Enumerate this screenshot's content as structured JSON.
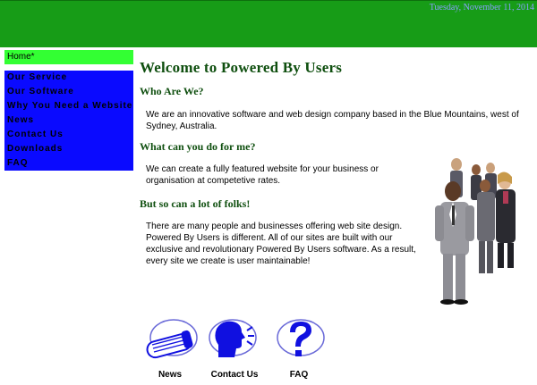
{
  "header": {
    "date": "Tuesday, November 11, 2014"
  },
  "nav": {
    "items": [
      {
        "label": "Home*",
        "active": true
      },
      {
        "label": "Our Service",
        "active": false
      },
      {
        "label": "Our Software",
        "active": false
      },
      {
        "label": "Why You Need a Website",
        "active": false
      },
      {
        "label": "News",
        "active": false
      },
      {
        "label": "Contact Us",
        "active": false
      },
      {
        "label": "Downloads",
        "active": false
      },
      {
        "label": "FAQ",
        "active": false
      }
    ]
  },
  "main": {
    "title": "Welcome to Powered By Users",
    "sections": [
      {
        "heading": "Who Are We?",
        "text": "We are an innovative software and web design company based in the Blue Mountains, west of Sydney, Australia."
      },
      {
        "heading": "What can you do for me?",
        "text": "We can create a fully featured website for your business or organisation at competetive rates."
      },
      {
        "heading": "But so can a lot of folks!",
        "text": "There are many people and businesses offering web site design. Powered By Users is different. All of our sites are built with our exclusive and revolutionary Powered By Users software. As a result, every site we create is user maintainable!"
      }
    ]
  },
  "footer_icons": [
    {
      "label": "News",
      "icon": "newspaper-icon"
    },
    {
      "label": "Contact Us",
      "icon": "speaking-head-icon"
    },
    {
      "label": "FAQ",
      "icon": "question-mark-icon"
    }
  ],
  "colors": {
    "header_green": "#179c17",
    "nav_active": "#33ff33",
    "nav_blue": "#0a0aff",
    "heading_green": "#0f4f0f",
    "date_blue": "#8aa0ff",
    "icon_blue": "#1010e0"
  }
}
